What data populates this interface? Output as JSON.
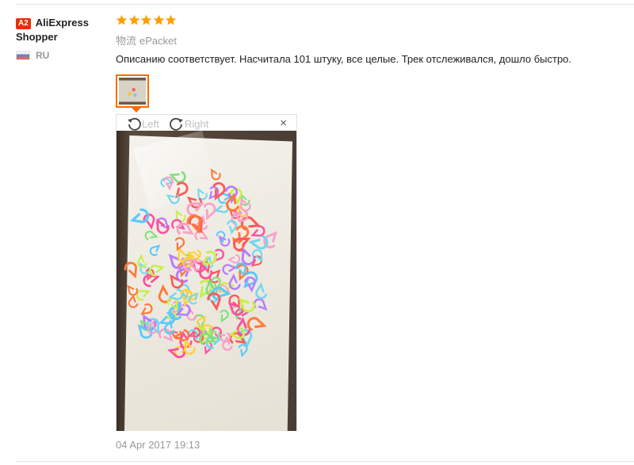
{
  "user": {
    "badge": "A2",
    "name_line1": "AliExpress",
    "name_line2": "Shopper",
    "country": "RU"
  },
  "review": {
    "rating": 5,
    "logistics_label": "物流",
    "logistics_value": "ePacket",
    "text": "Описанию соответствует. Насчитала 101 штуку, все целые. Трек отслеживался, дошло быстро.",
    "date": "04 Apr 2017 19:13"
  },
  "viewer": {
    "rotate_left_label": "Left",
    "rotate_right_label": "Right",
    "close_label": "×"
  },
  "colors": {
    "star": "#ff9c00",
    "accent": "#ff6a00",
    "badge": "#e62e04"
  }
}
